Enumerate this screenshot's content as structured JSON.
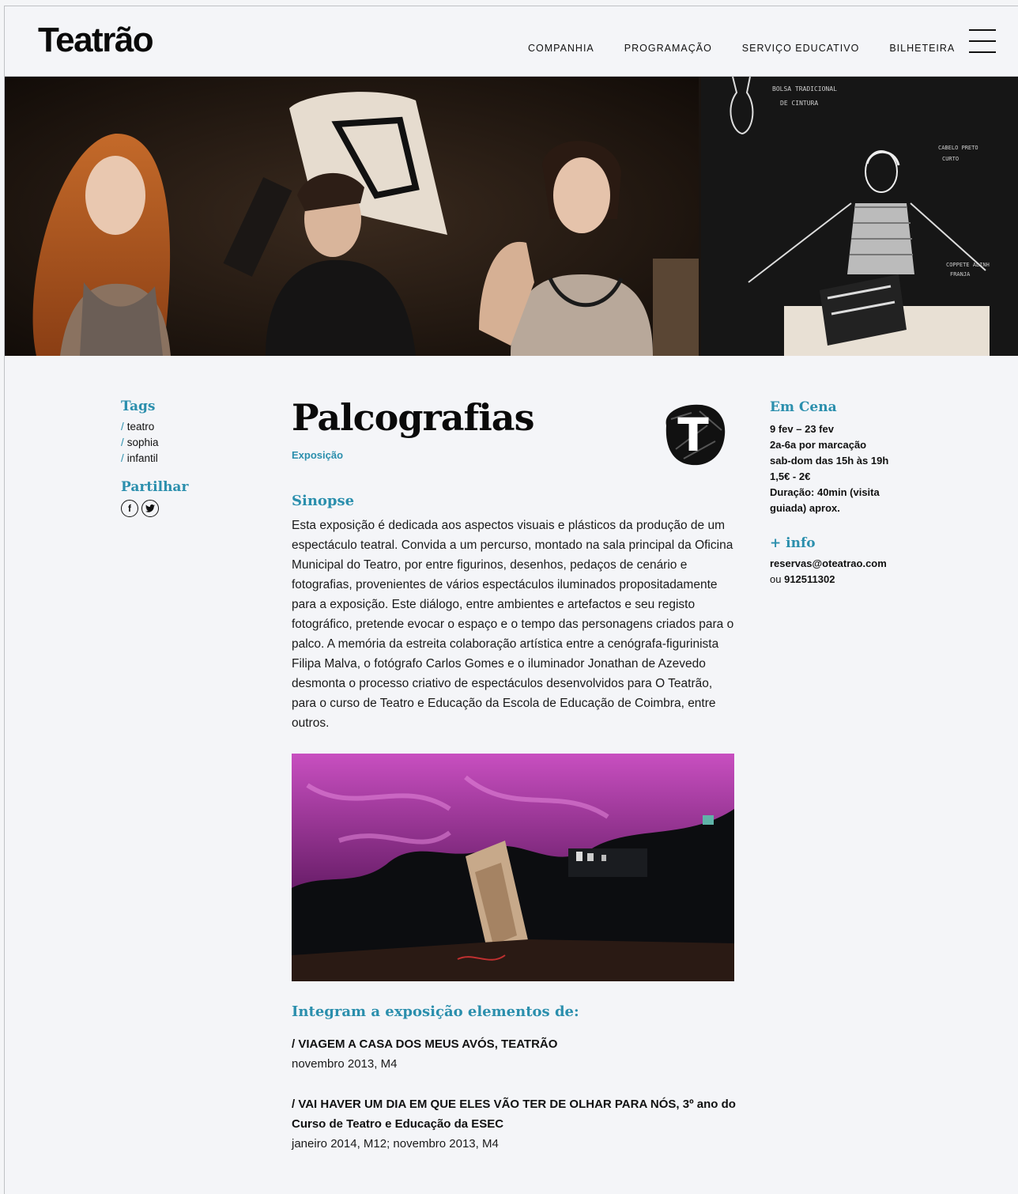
{
  "header": {
    "logo": "Teatrão",
    "nav": [
      "COMPANHIA",
      "PROGRAMAÇÃO",
      "SERVIÇO EDUCATIVO",
      "BILHETEIRA"
    ],
    "menu_icon": "hamburger-icon"
  },
  "hero": {
    "sketch_notes": [
      "BOLSA TRADICIONAL",
      "DE CINTURA",
      "CABELO PRETO",
      "CURTO",
      "COPPETE ALINH",
      "FRANJA"
    ]
  },
  "sidebar_left": {
    "tags_title": "Tags",
    "tags": [
      "teatro",
      "sophia",
      "infantil"
    ],
    "share_title": "Partilhar",
    "share_icons": [
      {
        "name": "facebook-icon",
        "glyph": "f"
      },
      {
        "name": "twitter-icon",
        "glyph": "t"
      }
    ]
  },
  "main": {
    "title": "Palcografias",
    "category": "Exposição",
    "badge_letter": "T",
    "sinopse_title": "Sinopse",
    "sinopse_text": "Esta exposição é dedicada aos aspectos visuais e plásticos da produção de um espectáculo teatral. Convida a um percurso, montado na sala principal da Oficina Municipal do Teatro, por entre figurinos, desenhos, pedaços de cenário e fotografias, provenientes de vários espectáculos iluminados propositadamente para a exposição. Este diálogo, entre ambientes e artefactos e seu registo fotográfico, pretende evocar o espaço e o tempo das personagens criados para o palco. A memória da estreita colaboração artística entre a cenógrafa-figurinista Filipa Malva, o fotógrafo Carlos Gomes e o iluminador Jonathan de Azevedo desmonta o processo criativo de espectáculos desenvolvidos para O Teatrão, para o curso de Teatro e Educação da Escola de Educação de Coimbra, entre outros.",
    "elements_title": "Integram a exposição elementos de:",
    "elements": [
      {
        "name": "/ VIAGEM A CASA DOS MEUS AVÓS, TEATRÃO",
        "date": "novembro 2013, M4"
      },
      {
        "name": "/ VAI HAVER UM DIA EM QUE ELES VÃO TER DE OLHAR PARA NÓS, 3º ano do Curso de Teatro e Educação da ESEC",
        "date": "janeiro 2014, M12; novembro 2013, M4"
      }
    ]
  },
  "sidebar_right": {
    "cena_title": "Em Cena",
    "cena_lines": [
      "9 fev – 23 fev",
      "2a-6a por marcação",
      "sab-dom das 15h às 19h",
      "1,5€ - 2€",
      "Duração: 40min (visita guiada) aprox."
    ],
    "info_title": "+ info",
    "info_email": "reservas@oteatrao.com",
    "info_or": "ou",
    "info_phone": "912511302"
  },
  "colors": {
    "accent": "#2b8fad",
    "text": "#111111",
    "background": "#f4f5f8"
  }
}
